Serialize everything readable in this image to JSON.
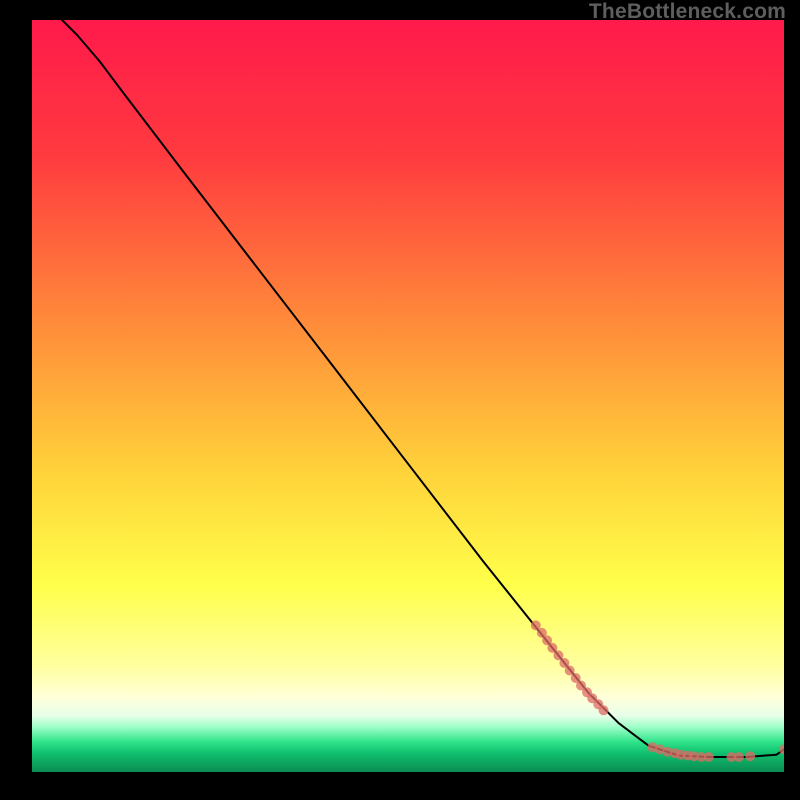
{
  "watermark": "TheBottleneck.com",
  "chart_data": {
    "type": "line",
    "title": "",
    "xlabel": "",
    "ylabel": "",
    "xlim": [
      0,
      100
    ],
    "ylim": [
      0,
      100
    ],
    "gradient_stops": [
      {
        "offset": 0,
        "color": "#ff1a4b"
      },
      {
        "offset": 18,
        "color": "#ff3a3f"
      },
      {
        "offset": 40,
        "color": "#ff8a3a"
      },
      {
        "offset": 60,
        "color": "#ffd23a"
      },
      {
        "offset": 75,
        "color": "#ffff4a"
      },
      {
        "offset": 86,
        "color": "#ffffa0"
      },
      {
        "offset": 90,
        "color": "#ffffd8"
      },
      {
        "offset": 92.5,
        "color": "#e8ffe8"
      },
      {
        "offset": 94,
        "color": "#9dffc8"
      },
      {
        "offset": 96,
        "color": "#30e38a"
      },
      {
        "offset": 97.5,
        "color": "#0fbf6e"
      },
      {
        "offset": 100,
        "color": "#0a8c52"
      }
    ],
    "series": [
      {
        "name": "bottleneck-curve",
        "type": "line",
        "color": "#000000",
        "points": [
          {
            "x": 4.0,
            "y": 100.0
          },
          {
            "x": 6.0,
            "y": 98.0
          },
          {
            "x": 9.0,
            "y": 94.5
          },
          {
            "x": 12.0,
            "y": 90.5
          },
          {
            "x": 20.0,
            "y": 80.0
          },
          {
            "x": 30.0,
            "y": 67.0
          },
          {
            "x": 40.0,
            "y": 54.0
          },
          {
            "x": 50.0,
            "y": 41.0
          },
          {
            "x": 60.0,
            "y": 28.0
          },
          {
            "x": 68.0,
            "y": 18.0
          },
          {
            "x": 74.0,
            "y": 10.5
          },
          {
            "x": 78.0,
            "y": 6.5
          },
          {
            "x": 82.0,
            "y": 3.5
          },
          {
            "x": 86.0,
            "y": 2.2
          },
          {
            "x": 90.0,
            "y": 2.0
          },
          {
            "x": 95.0,
            "y": 2.0
          },
          {
            "x": 99.0,
            "y": 2.3
          },
          {
            "x": 100.0,
            "y": 3.0
          }
        ]
      },
      {
        "name": "highlighted-points",
        "type": "scatter",
        "color": "#dd6b66",
        "radius": 5,
        "points": [
          {
            "x": 67.0,
            "y": 19.5
          },
          {
            "x": 67.8,
            "y": 18.5
          },
          {
            "x": 68.5,
            "y": 17.5
          },
          {
            "x": 69.2,
            "y": 16.5
          },
          {
            "x": 70.0,
            "y": 15.5
          },
          {
            "x": 70.8,
            "y": 14.5
          },
          {
            "x": 71.5,
            "y": 13.5
          },
          {
            "x": 72.3,
            "y": 12.5
          },
          {
            "x": 73.0,
            "y": 11.5
          },
          {
            "x": 73.8,
            "y": 10.6
          },
          {
            "x": 74.5,
            "y": 9.8
          },
          {
            "x": 75.3,
            "y": 9.0
          },
          {
            "x": 76.0,
            "y": 8.2
          },
          {
            "x": 82.5,
            "y": 3.3
          },
          {
            "x": 83.5,
            "y": 3.0
          },
          {
            "x": 84.5,
            "y": 2.7
          },
          {
            "x": 85.5,
            "y": 2.5
          },
          {
            "x": 86.3,
            "y": 2.3
          },
          {
            "x": 87.2,
            "y": 2.2
          },
          {
            "x": 88.0,
            "y": 2.1
          },
          {
            "x": 89.0,
            "y": 2.0
          },
          {
            "x": 90.0,
            "y": 2.0
          },
          {
            "x": 93.0,
            "y": 2.0
          },
          {
            "x": 94.0,
            "y": 2.0
          },
          {
            "x": 95.5,
            "y": 2.1
          },
          {
            "x": 100.0,
            "y": 3.0
          }
        ]
      }
    ]
  }
}
